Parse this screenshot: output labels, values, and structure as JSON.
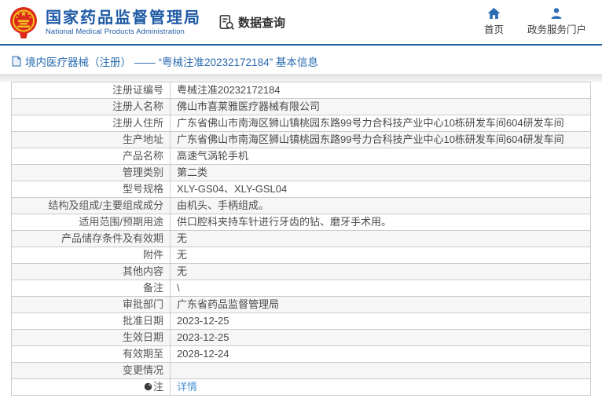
{
  "header": {
    "brand": {
      "title": "国家药品监督管理局",
      "subtitle": "National Medical Products Administration"
    },
    "data_query_label": "数据查询",
    "nav": [
      {
        "label": "首页",
        "icon": "home-icon"
      },
      {
        "label": "政务服务门户",
        "icon": "user-icon"
      }
    ]
  },
  "breadcrumb": {
    "title": "境内医疗器械（注册） —— “粤械注准20232172184” 基本信息"
  },
  "table": {
    "rows": [
      {
        "label": "注册证编号",
        "value": "粤械注准20232172184"
      },
      {
        "label": "注册人名称",
        "value": "佛山市喜莱雅医疗器械有限公司"
      },
      {
        "label": "注册人住所",
        "value": "广东省佛山市南海区狮山镇桃园东路99号力合科技产业中心10栋研发车间604研发车间"
      },
      {
        "label": "生产地址",
        "value": "广东省佛山市南海区狮山镇桃园东路99号力合科技产业中心10栋研发车间604研发车间"
      },
      {
        "label": "产品名称",
        "value": "高速气涡轮手机"
      },
      {
        "label": "管理类别",
        "value": "第二类"
      },
      {
        "label": "型号规格",
        "value": "XLY-GS04、XLY-GSL04"
      },
      {
        "label": "结构及组成/主要组成成分",
        "value": "由机头、手柄组成。"
      },
      {
        "label": "适用范围/预期用途",
        "value": "供口腔科夹持车针进行牙齿的钻、磨牙手术用。"
      },
      {
        "label": "产品储存条件及有效期",
        "value": "无"
      },
      {
        "label": "附件",
        "value": "无"
      },
      {
        "label": "其他内容",
        "value": "无"
      },
      {
        "label": "备注",
        "value": "\\"
      },
      {
        "label": "审批部门",
        "value": "广东省药品监督管理局"
      },
      {
        "label": "批准日期",
        "value": "2023-12-25"
      },
      {
        "label": "生效日期",
        "value": "2023-12-25"
      },
      {
        "label": "有效期至",
        "value": "2028-12-24"
      },
      {
        "label": "变更情况",
        "value": ""
      },
      {
        "label": "注",
        "icon": "note-icon",
        "value": "详情",
        "value_type": "link"
      }
    ]
  },
  "colors": {
    "brand_blue": "#1e5aa5",
    "header_border_blue": "#24619f",
    "breadcrumb_blue": "#2a6cb0",
    "link_blue": "#4f94d6",
    "row_alt_gray": "#f6f6f6",
    "table_border_gray": "#cccccc",
    "emblem_red": "#dd2a1b",
    "emblem_yellow": "#f5c31f"
  }
}
